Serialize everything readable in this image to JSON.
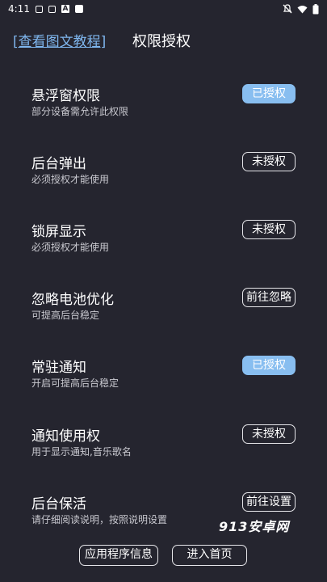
{
  "status_bar": {
    "time": "4:11",
    "left_icons": [
      "mail-icon",
      "image-icon",
      "app-icon",
      "square-icon"
    ],
    "right_icons": [
      "mute-icon",
      "wifi-icon",
      "battery-icon"
    ]
  },
  "header": {
    "help_link": "[查看图文教程]",
    "title": "权限授权"
  },
  "permissions": [
    {
      "title": "悬浮窗权限",
      "desc": "部分设备需允许此权限",
      "button": "已授权",
      "state": "granted"
    },
    {
      "title": "后台弹出",
      "desc": "必须授权才能使用",
      "button": "未授权",
      "state": "denied"
    },
    {
      "title": "锁屏显示",
      "desc": "必须授权才能使用",
      "button": "未授权",
      "state": "denied"
    },
    {
      "title": "忽略电池优化",
      "desc": "可提高后台稳定",
      "button": "前往忽略",
      "state": "action"
    },
    {
      "title": "常驻通知",
      "desc": "开启可提高后台稳定",
      "button": "已授权",
      "state": "granted"
    },
    {
      "title": "通知使用权",
      "desc": "用于显示通知,音乐歌名",
      "button": "未授权",
      "state": "denied"
    },
    {
      "title": "后台保活",
      "desc": "请仔细阅读说明，按照说明设置",
      "button": "前往设置",
      "state": "action"
    }
  ],
  "footer": {
    "app_info_button": "应用程序信息",
    "enter_home_button": "进入首页"
  },
  "watermark": "913安卓网",
  "colors": {
    "background": "#25252f",
    "granted": "#88bef0",
    "link": "#7fb6ee"
  }
}
